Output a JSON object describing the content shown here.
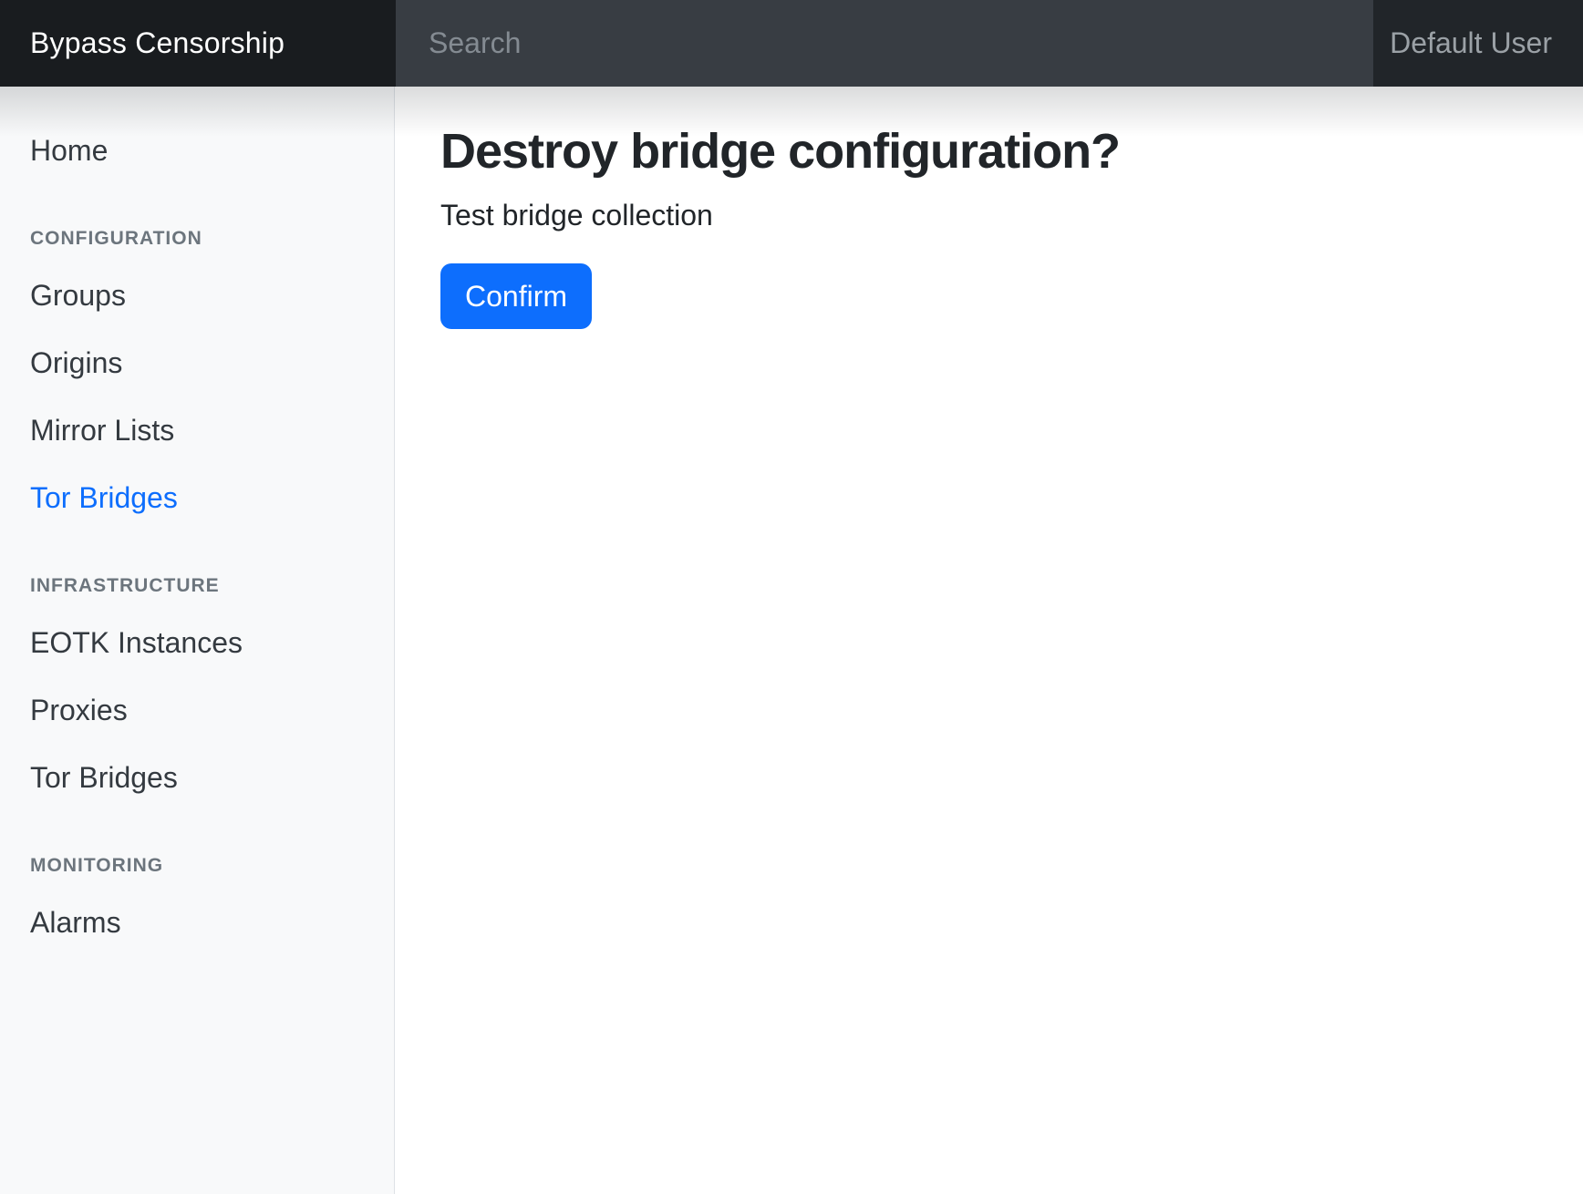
{
  "navbar": {
    "brand": "Bypass Censorship",
    "search_placeholder": "Search",
    "user": "Default User"
  },
  "sidebar": {
    "home": {
      "label": "Home"
    },
    "sections": [
      {
        "heading": "CONFIGURATION",
        "items": [
          {
            "label": "Groups",
            "active": false
          },
          {
            "label": "Origins",
            "active": false
          },
          {
            "label": "Mirror Lists",
            "active": false
          },
          {
            "label": "Tor Bridges",
            "active": true
          }
        ]
      },
      {
        "heading": "INFRASTRUCTURE",
        "items": [
          {
            "label": "EOTK Instances",
            "active": false
          },
          {
            "label": "Proxies",
            "active": false
          },
          {
            "label": "Tor Bridges",
            "active": false
          }
        ]
      },
      {
        "heading": "MONITORING",
        "items": [
          {
            "label": "Alarms",
            "active": false
          }
        ]
      }
    ]
  },
  "main": {
    "title": "Destroy bridge configuration?",
    "subtitle": "Test bridge collection",
    "confirm_label": "Confirm"
  },
  "colors": {
    "accent": "#0d6efd",
    "navbar_brand_bg": "#191c1f",
    "navbar_search_bg": "#383d43",
    "navbar_user_bg": "#212529",
    "sidebar_bg": "#f8f9fa",
    "sidebar_border": "#dee2e6",
    "text_dark": "#212529",
    "section_heading": "#6c757d"
  }
}
